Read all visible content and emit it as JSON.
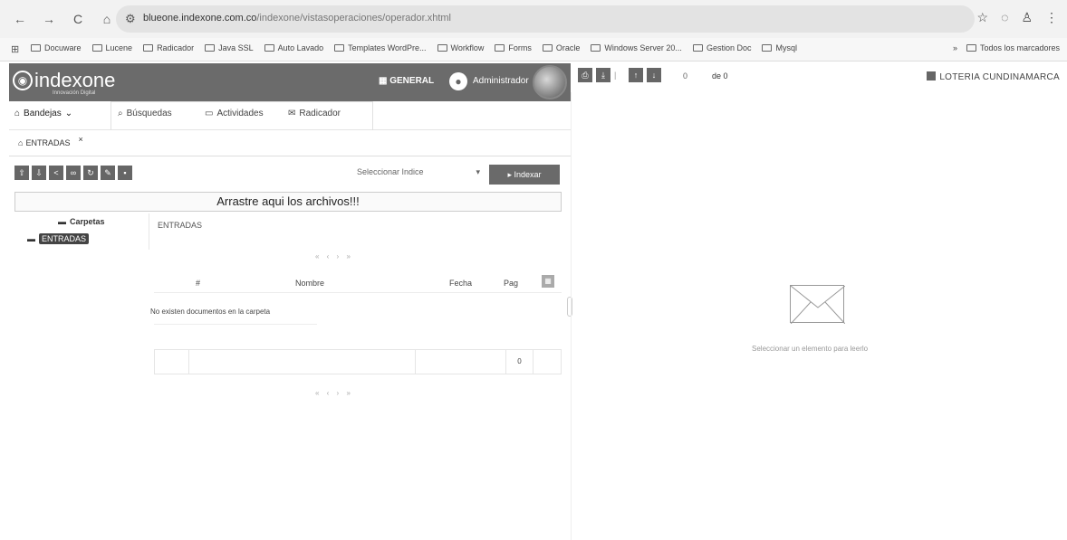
{
  "browser": {
    "url_domain": "blueone.indexone.com.co",
    "url_path": "/indexone/vistasoperaciones/operador.xhtml",
    "bookmarks": [
      "Docuware",
      "Lucene",
      "Radicador",
      "Java SSL",
      "Auto Lavado",
      "Templates WordPre...",
      "Workflow",
      "Forms",
      "Oracle",
      "Windows Server 20...",
      "Gestion Doc",
      "Mysql"
    ],
    "bookmarks_more": "»",
    "all_bookmarks": "Todos los marcadores"
  },
  "app": {
    "logo": "indexone",
    "logo_sub": "Innovación Digital",
    "general_label": "GENERAL",
    "user_label": "Administrador",
    "tabs": {
      "bandejas": "Bandejas",
      "busquedas": "Búsquedas",
      "actividades": "Actividades",
      "radicador": "Radicador"
    },
    "subtab": "ENTRADAS",
    "subtab_close": "×",
    "select_index_placeholder": "Seleccionar Indice",
    "indexar_label": "Indexar",
    "dropzone_text": "Arrastre aqui los archivos!!!",
    "tree_header": "Carpetas",
    "tree_item": "ENTRADAS",
    "breadcrumb": "ENTRADAS",
    "pager": "« ‹ › »",
    "table_headers": {
      "num": "#",
      "nombre": "Nombre",
      "fecha": "Fecha",
      "pag": "Pag"
    },
    "empty_message": "No existen documentos en la carpeta",
    "footer_count": "0"
  },
  "viewer": {
    "page_value": "0",
    "de_label": "de 0",
    "entity": "LOTERIA CUNDINAMARCA",
    "empty_message": "Seleccionar un elemento para leerlo"
  }
}
